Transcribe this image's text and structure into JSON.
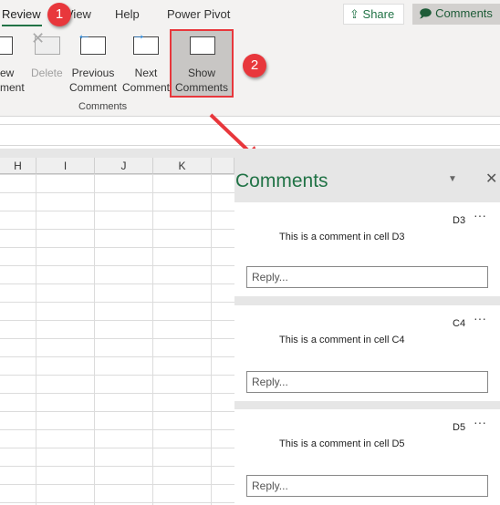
{
  "ribbon": {
    "tabs": [
      "Review",
      "View",
      "Help",
      "Power Pivot"
    ],
    "share": "Share",
    "comments": "Comments",
    "buttons": [
      {
        "label1": "ew",
        "label2": "ment"
      },
      {
        "label1": "Delete",
        "label2": ""
      },
      {
        "label1": "Previous",
        "label2": "Comment"
      },
      {
        "label1": "Next",
        "label2": "Comment"
      },
      {
        "label1": "Show",
        "label2": "Comments"
      }
    ],
    "group": "Comments"
  },
  "badges": [
    "1",
    "2"
  ],
  "columns": [
    "H",
    "I",
    "J",
    "K"
  ],
  "pane": {
    "title": "Comments",
    "cards": [
      {
        "cell": "D3",
        "text": "This is a comment in cell D3",
        "placeholder": "Reply..."
      },
      {
        "cell": "C4",
        "text": "This is a comment in cell C4",
        "placeholder": "Reply..."
      },
      {
        "cell": "D5",
        "text": "This is a comment in cell D5",
        "placeholder": "Reply..."
      }
    ]
  },
  "colors": {
    "accent": "#217346",
    "badge": "#e8373c"
  }
}
